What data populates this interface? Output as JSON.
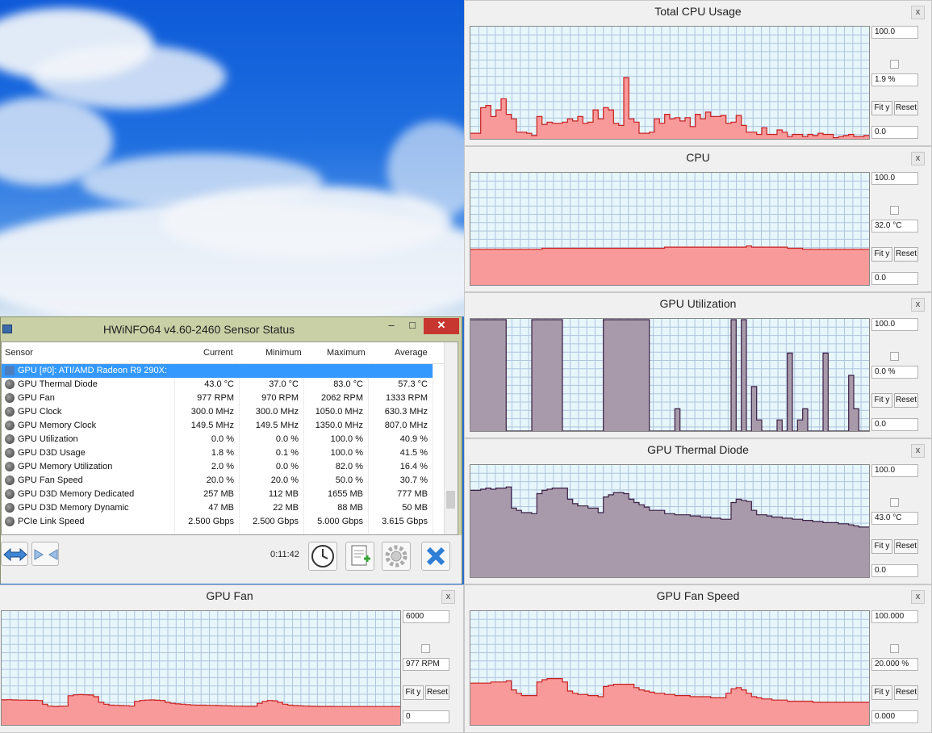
{
  "sensor_window": {
    "title": "HWiNFO64 v4.60-2460 Sensor Status",
    "minimize": "–",
    "maximize": "□",
    "close": "✕",
    "columns": [
      "Sensor",
      "Current",
      "Minimum",
      "Maximum",
      "Average"
    ],
    "group_row": "GPU [#0]: ATI/AMD Radeon R9 290X:",
    "rows": [
      {
        "name": "GPU Thermal Diode",
        "icon": "thermometer-icon",
        "current": "43.0 °C",
        "minimum": "37.0 °C",
        "maximum": "83.0 °C",
        "average": "57.3 °C"
      },
      {
        "name": "GPU Fan",
        "icon": "fan-icon",
        "current": "977 RPM",
        "minimum": "970 RPM",
        "maximum": "2062 RPM",
        "average": "1333 RPM"
      },
      {
        "name": "GPU Clock",
        "icon": "gauge-icon",
        "current": "300.0 MHz",
        "minimum": "300.0 MHz",
        "maximum": "1050.0 MHz",
        "average": "630.3 MHz"
      },
      {
        "name": "GPU Memory Clock",
        "icon": "gauge-icon",
        "current": "149.5 MHz",
        "minimum": "149.5 MHz",
        "maximum": "1350.0 MHz",
        "average": "807.0 MHz"
      },
      {
        "name": "GPU Utilization",
        "icon": "gauge-icon",
        "current": "0.0 %",
        "minimum": "0.0 %",
        "maximum": "100.0 %",
        "average": "40.9 %"
      },
      {
        "name": "GPU D3D Usage",
        "icon": "gauge-icon",
        "current": "1.8 %",
        "minimum": "0.1 %",
        "maximum": "100.0 %",
        "average": "41.5 %"
      },
      {
        "name": "GPU Memory Utilization",
        "icon": "gauge-icon",
        "current": "2.0 %",
        "minimum": "0.0 %",
        "maximum": "82.0 %",
        "average": "16.4 %"
      },
      {
        "name": "GPU Fan Speed",
        "icon": "gauge-icon",
        "current": "20.0 %",
        "minimum": "20.0 %",
        "maximum": "50.0 %",
        "average": "30.7 %"
      },
      {
        "name": "GPU D3D Memory Dedicated",
        "icon": "gauge-icon",
        "current": "257 MB",
        "minimum": "112 MB",
        "maximum": "1655 MB",
        "average": "777 MB"
      },
      {
        "name": "GPU D3D Memory Dynamic",
        "icon": "gauge-icon",
        "current": "47 MB",
        "minimum": "22 MB",
        "maximum": "88 MB",
        "average": "50 MB"
      },
      {
        "name": "PCIe Link Speed",
        "icon": "gauge-icon",
        "current": "2.500 Gbps",
        "minimum": "2.500 Gbps",
        "maximum": "5.000 Gbps",
        "average": "3.615 Gbps"
      }
    ],
    "elapsed": "0:11:42",
    "footer_icons": [
      "expand-arrows-icon",
      "collapse-arrows-icon",
      "clock-icon",
      "report-icon",
      "settings-gear-icon",
      "close-x-icon"
    ]
  },
  "graphs": [
    {
      "id": "total-cpu-usage",
      "title": "Total CPU Usage",
      "max": "100.0",
      "current": "1.9 %",
      "min": "0.0",
      "fit": "Fit y",
      "reset": "Reset",
      "close": "x",
      "color": "#f99a9a",
      "line": "#c81e1e",
      "series": [
        5,
        5,
        28,
        30,
        20,
        26,
        36,
        22,
        18,
        6,
        6,
        5,
        3,
        20,
        13,
        15,
        14,
        14,
        15,
        18,
        16,
        20,
        14,
        15,
        26,
        18,
        28,
        26,
        14,
        12,
        55,
        18,
        15,
        5,
        5,
        6,
        18,
        14,
        22,
        18,
        19,
        16,
        19,
        11,
        22,
        18,
        24,
        20,
        20,
        21,
        14,
        15,
        21,
        12,
        6,
        6,
        4,
        10,
        4,
        4,
        8,
        6,
        2,
        4,
        4,
        2,
        4,
        3,
        5,
        4,
        4,
        1,
        2,
        3,
        4,
        2,
        2,
        3
      ]
    },
    {
      "id": "cpu",
      "title": "CPU",
      "max": "100.0",
      "current": "32.0 °C",
      "min": "0.0",
      "fit": "Fit y",
      "reset": "Reset",
      "close": "x",
      "color": "#f99a9a",
      "line": "#c81e1e",
      "series": [
        32,
        32,
        32,
        32,
        32,
        32,
        32,
        32,
        32,
        32,
        32,
        32,
        32,
        32,
        33,
        33,
        33,
        33,
        33,
        33,
        33,
        33,
        33,
        33,
        33,
        33,
        33,
        33,
        33,
        33,
        33,
        33,
        33,
        33,
        33,
        33,
        33,
        33,
        34,
        34,
        34,
        34,
        34,
        34,
        34,
        34,
        34,
        34,
        34,
        34,
        34,
        34,
        34,
        34,
        35,
        34,
        34,
        34,
        34,
        34,
        34,
        34,
        33,
        33,
        33,
        32,
        32,
        32,
        32,
        32,
        32,
        32,
        32,
        32,
        32,
        32,
        32,
        32
      ]
    },
    {
      "id": "gpu-utilization",
      "title": "GPU Utilization",
      "max": "100.0",
      "current": "0.0 %",
      "min": "0.0",
      "fit": "Fit y",
      "reset": "Reset",
      "close": "x",
      "color": "#a89aaa",
      "line": "#3a1f45",
      "series": [
        100,
        100,
        100,
        100,
        100,
        100,
        100,
        0,
        0,
        0,
        0,
        0,
        100,
        100,
        100,
        100,
        100,
        100,
        0,
        0,
        0,
        0,
        0,
        0,
        0,
        0,
        100,
        100,
        100,
        100,
        100,
        100,
        100,
        100,
        100,
        0,
        0,
        0,
        0,
        0,
        20,
        0,
        0,
        0,
        0,
        0,
        0,
        0,
        0,
        0,
        0,
        100,
        0,
        100,
        0,
        40,
        10,
        0,
        0,
        0,
        10,
        0,
        70,
        0,
        10,
        20,
        0,
        0,
        0,
        70,
        0,
        0,
        0,
        0,
        50,
        20,
        0,
        0
      ]
    },
    {
      "id": "gpu-thermal-diode",
      "title": "GPU Thermal Diode",
      "max": "100.0",
      "current": "43.0 °C",
      "min": "0.0",
      "fit": "Fit y",
      "reset": "Reset",
      "close": "x",
      "color": "#a89aaa",
      "line": "#3a1f45",
      "series": [
        78,
        78,
        79,
        80,
        79,
        80,
        80,
        81,
        62,
        60,
        58,
        58,
        57,
        75,
        78,
        79,
        80,
        80,
        80,
        70,
        66,
        64,
        64,
        62,
        62,
        58,
        72,
        74,
        76,
        76,
        75,
        70,
        67,
        65,
        63,
        60,
        60,
        60,
        57,
        57,
        56,
        56,
        56,
        55,
        55,
        54,
        54,
        53,
        53,
        52,
        52,
        67,
        70,
        69,
        68,
        60,
        56,
        56,
        55,
        54,
        54,
        53,
        53,
        52,
        52,
        51,
        51,
        50,
        50,
        49,
        49,
        49,
        48,
        48,
        47,
        46,
        45,
        45
      ]
    },
    {
      "id": "gpu-fan",
      "title": "GPU Fan",
      "max": "6000",
      "current": "977 RPM",
      "min": "0",
      "fit": "Fit y",
      "reset": "Reset",
      "close": "x",
      "color": "#f99a9a",
      "line": "#c81e1e",
      "series": [
        1333,
        1340,
        1330,
        1320,
        1320,
        1310,
        1310,
        1300,
        1100,
        1000,
        980,
        990,
        1000,
        1550,
        1600,
        1610,
        1600,
        1590,
        1500,
        1200,
        1100,
        1050,
        1040,
        1030,
        1020,
        1000,
        1250,
        1300,
        1320,
        1330,
        1310,
        1300,
        1200,
        1150,
        1120,
        1100,
        1080,
        1060,
        1050,
        1050,
        1040,
        1040,
        1030,
        1020,
        1010,
        1000,
        1000,
        990,
        990,
        990,
        1150,
        1250,
        1300,
        1280,
        1200,
        1100,
        1050,
        1030,
        1010,
        1000,
        990,
        985,
        980,
        980,
        980,
        978,
        978,
        977,
        977,
        977,
        977,
        977,
        977,
        977,
        977,
        977,
        977,
        977
      ]
    },
    {
      "id": "gpu-fan-speed",
      "title": "GPU Fan Speed",
      "max": "100.000",
      "current": "20.000 %",
      "min": "0.000",
      "fit": "Fit y",
      "reset": "Reset",
      "close": "x",
      "color": "#f99a9a",
      "line": "#c81e1e",
      "series": [
        37,
        37,
        37,
        37,
        38,
        38,
        38,
        39,
        31,
        28,
        26,
        26,
        26,
        38,
        40,
        41,
        41,
        41,
        38,
        30,
        28,
        27,
        27,
        26,
        26,
        25,
        34,
        35,
        36,
        36,
        36,
        36,
        33,
        31,
        30,
        29,
        28,
        28,
        27,
        27,
        26,
        26,
        26,
        25,
        25,
        25,
        25,
        24,
        24,
        24,
        28,
        32,
        33,
        31,
        28,
        25,
        24,
        23,
        23,
        22,
        22,
        22,
        21,
        21,
        21,
        21,
        21,
        20,
        20,
        20,
        20,
        20,
        20,
        20,
        20,
        20,
        20,
        20
      ]
    }
  ]
}
